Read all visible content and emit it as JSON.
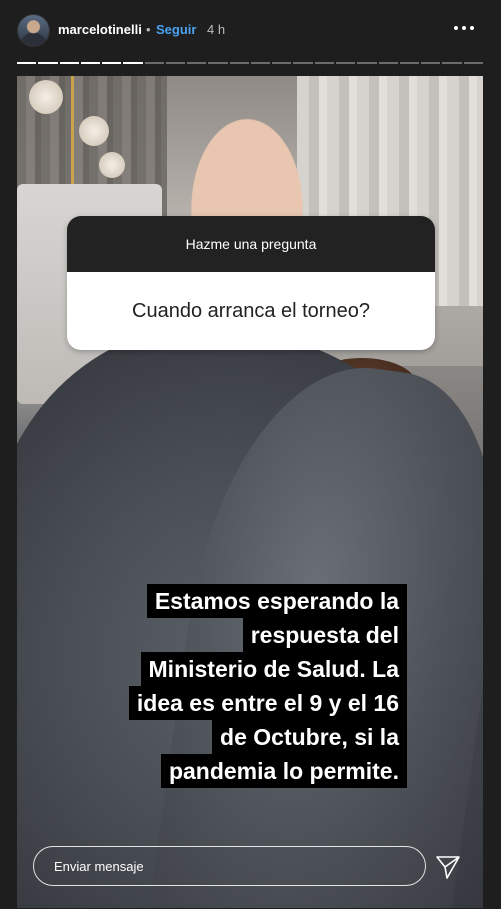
{
  "header": {
    "username": "marcelotinelli",
    "separator": "•",
    "follow_label": "Seguir",
    "time": "4 h",
    "more_icon": "more-horizontal-icon"
  },
  "progress": {
    "segments": 22,
    "completed": 6
  },
  "question_sticker": {
    "prompt": "Hazme una pregunta",
    "question": "Cuando arranca el torneo?"
  },
  "caption": {
    "lines": [
      "Estamos esperando la",
      "respuesta del",
      "Ministerio de Salud. La",
      "idea es entre el 9 y el 16",
      "de Octubre, si la",
      "pandemia lo permite."
    ]
  },
  "reply": {
    "placeholder": "Enviar mensaje",
    "send_icon": "send-icon"
  },
  "colors": {
    "background": "#1e1e1e",
    "follow": "#4aa3f0",
    "caption_bg": "#000000"
  }
}
